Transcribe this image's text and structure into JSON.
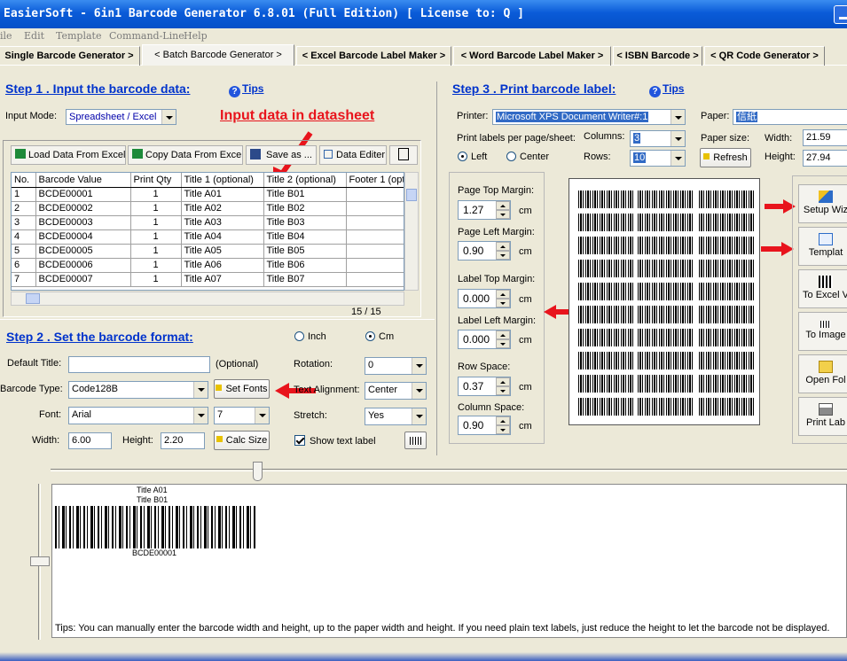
{
  "window": {
    "title": "EasierSoft - 6in1 Barcode Generator  6.8.01  (Full Edition) [ License to: Q ]"
  },
  "menu": [
    "ile",
    "Edit",
    "Template",
    "Command-Line",
    "Help"
  ],
  "tabs": [
    "Single Barcode Generator >",
    "< Batch Barcode Generator >",
    "< Excel Barcode Label Maker >",
    "< Word Barcode Label Maker >",
    "< ISBN Barcode >",
    "< QR Code Generator >"
  ],
  "step1": {
    "title": "Step 1 .  Input the barcode data:",
    "tips": "Tips",
    "input_mode_label": "Input Mode:",
    "input_mode": "Spreadsheet / Excel",
    "annotation": "Input data in datasheet",
    "toolbar": {
      "load": "Load Data From Excel",
      "copy": "Copy Data From Excel",
      "save": "Save as ...",
      "editor": "Data Editer"
    },
    "columns": [
      "No.",
      "Barcode Value",
      "Print Qty",
      "Title 1 (optional)",
      "Title 2 (optional)",
      "Footer 1 (opt"
    ],
    "rows": [
      [
        "1",
        "BCDE00001",
        "1",
        "Title A01",
        "Title B01",
        ""
      ],
      [
        "2",
        "BCDE00002",
        "1",
        "Title A02",
        "Title B02",
        ""
      ],
      [
        "3",
        "BCDE00003",
        "1",
        "Title A03",
        "Title B03",
        ""
      ],
      [
        "4",
        "BCDE00004",
        "1",
        "Title A04",
        "Title B04",
        ""
      ],
      [
        "5",
        "BCDE00005",
        "1",
        "Title A05",
        "Title B05",
        ""
      ],
      [
        "6",
        "BCDE00006",
        "1",
        "Title A06",
        "Title B06",
        ""
      ],
      [
        "7",
        "BCDE00007",
        "1",
        "Title A07",
        "Title B07",
        ""
      ]
    ],
    "page_count": "15 / 15"
  },
  "step2": {
    "title": "Step 2 . Set the barcode format:",
    "unit_inch": "Inch",
    "unit_cm": "Cm",
    "default_title_label": "Default Title:",
    "default_title": "",
    "optional": "(Optional)",
    "rotation_label": "Rotation:",
    "rotation": "0",
    "barcode_type_label": "Barcode Type:",
    "barcode_type": "Code128B",
    "set_fonts": "Set Fonts",
    "text_alignment_label": "Text Alignment:",
    "text_alignment": "Center",
    "font_label": "Font:",
    "font": "Arial",
    "font_size": "7",
    "stretch_label": "Stretch:",
    "stretch": "Yes",
    "width_label": "Width:",
    "width": "6.00",
    "height_label": "Height:",
    "height": "2.20",
    "calc_size": "Calc Size",
    "show_text_label": "Show text label"
  },
  "step3": {
    "title": "Step 3 . Print barcode label:",
    "tips": "Tips",
    "printer_label": "Printer:",
    "printer": "Microsoft XPS Document Writer#:1",
    "paper_label": "Paper:",
    "paper": "信紙",
    "per_page_label": "Print labels per page/sheet:",
    "columns_label": "Columns:",
    "columns": "3",
    "rows_label": "Rows:",
    "rows": "10",
    "align_left": "Left",
    "align_center": "Center",
    "paper_size_label": "Paper size:",
    "width_label": "Width:",
    "paper_width": "21.59",
    "height_label": "Height:",
    "paper_height": "27.94",
    "refresh": "Refresh",
    "margins": [
      {
        "label": "Page Top Margin:",
        "value": "1.27",
        "unit": "cm"
      },
      {
        "label": "Page Left Margin:",
        "value": "0.90",
        "unit": "cm"
      },
      {
        "label": "Label Top Margin:",
        "value": "0.000",
        "unit": "cm"
      },
      {
        "label": "Label Left Margin:",
        "value": "0.000",
        "unit": "cm"
      },
      {
        "label": "Row Space:",
        "value": "0.37",
        "unit": "cm"
      },
      {
        "label": "Column Space:",
        "value": "0.90",
        "unit": "cm"
      }
    ],
    "actions": [
      "Setup Wiz",
      "Templat",
      "To Excel V",
      "To Image",
      "Open Fol",
      "Print Lab"
    ]
  },
  "preview": {
    "title1": "Title A01",
    "title2": "Title B01",
    "value": "BCDE00001",
    "tips": "Tips: You can manually enter the barcode width and height, up to the paper width and height.     If you need plain text labels, just reduce the height to let the barcode not be displayed."
  },
  "colors": {
    "link": "#0033CC",
    "annotation": "#E8141C",
    "titlebar": "#0A5BD8"
  }
}
